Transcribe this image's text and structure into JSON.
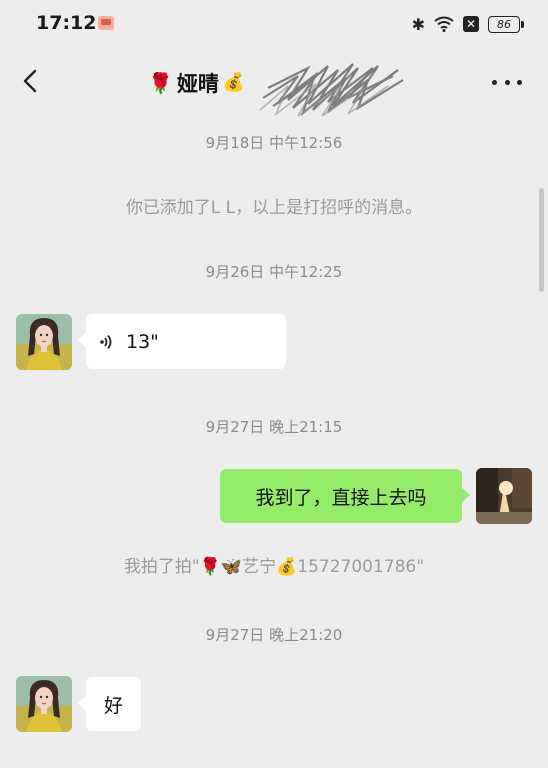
{
  "status_bar": {
    "time": "17:12",
    "bluetooth_icon": "bluetooth-icon",
    "wifi_icon": "wifi-icon",
    "x_icon": "✕",
    "battery": "86"
  },
  "header": {
    "title_prefix_emoji": "🌹",
    "title": "娅晴",
    "title_suffix_emoji": "💰",
    "back_icon": "chevron-left-icon",
    "more_icon": "more-dots-icon"
  },
  "messages": {
    "ts1": "9月18日 中午12:56",
    "sys1": "你已添加了L L，以上是打招呼的消息。",
    "ts2": "9月26日 中午12:25",
    "voice_duration": "13\"",
    "ts3": "9月27日 晚上21:15",
    "sent_text": "我到了，直接上去吗",
    "pat_text": "我拍了拍\"🌹🦋艺宁💰15727001786\"",
    "ts4": "9月27日 晚上21:20",
    "reply_text": "好"
  },
  "colors": {
    "background": "#ededed",
    "sent_bubble": "#95ec69",
    "received_bubble": "#ffffff",
    "timestamp_text": "#8a8a8a"
  }
}
